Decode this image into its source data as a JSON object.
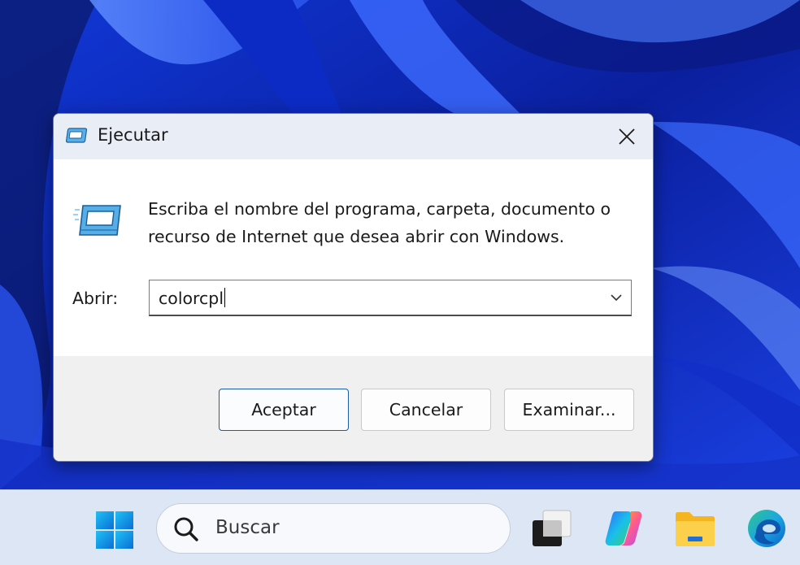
{
  "dialog": {
    "title": "Ejecutar",
    "description": "Escriba el nombre del programa, carpeta, documento o recurso de Internet que desea abrir con Windows.",
    "open_label": "Abrir:",
    "open_value": "colorcpl",
    "buttons": {
      "ok": "Aceptar",
      "cancel": "Cancelar",
      "browse": "Examinar..."
    }
  },
  "taskbar": {
    "search_placeholder": "Buscar",
    "apps": [
      "start-icon",
      "task-view-icon",
      "copilot-icon",
      "file-explorer-icon",
      "edge-icon"
    ]
  },
  "colors": {
    "accent": "#1f5aa8",
    "wallpaper": "#0a1f9e",
    "taskbar": "#dde6f5",
    "dialog_footer": "#f0f0f0"
  }
}
